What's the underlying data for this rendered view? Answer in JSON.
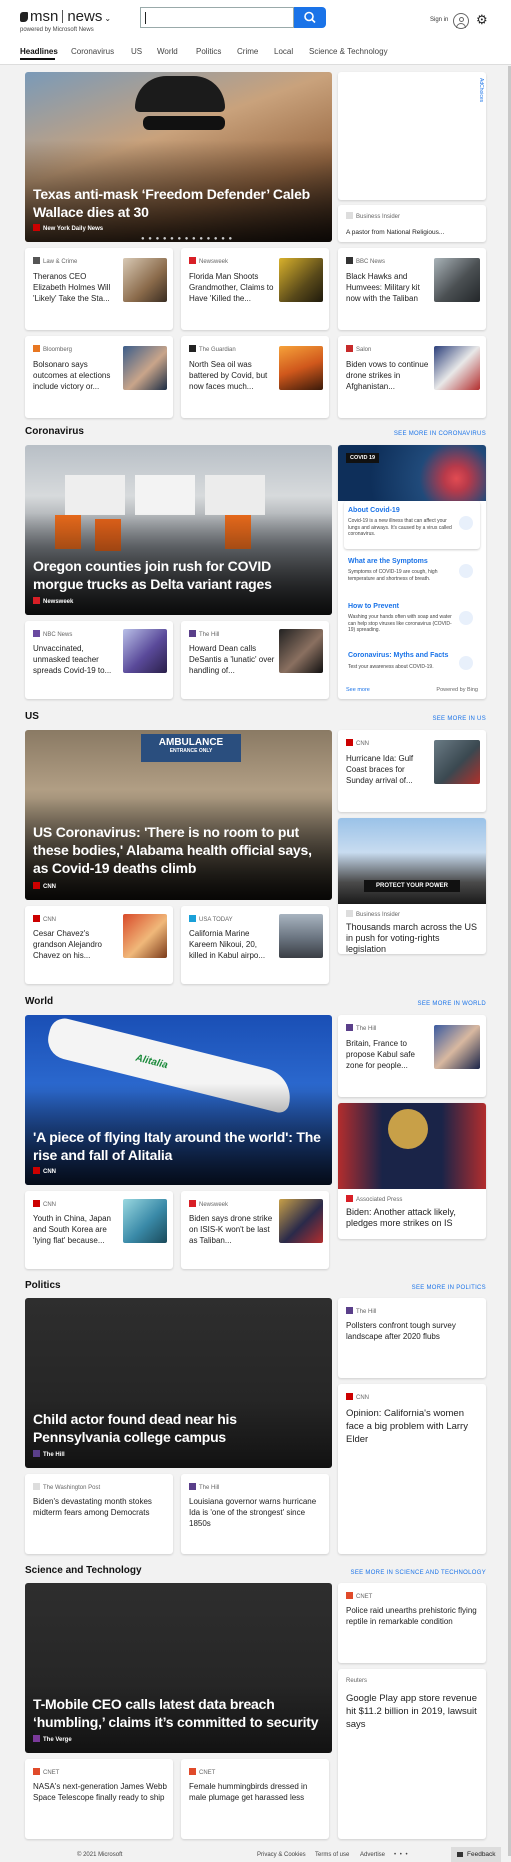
{
  "header": {
    "brand": "msn",
    "section": "news",
    "powered_by": "powered by Microsoft News",
    "search_placeholder": "",
    "sign_in": "Sign in"
  },
  "nav": [
    "Headlines",
    "Coronavirus",
    "US",
    "World",
    "Politics",
    "Crime",
    "Local",
    "Science & Technology"
  ],
  "ad": {
    "label": "AdChoices"
  },
  "top": {
    "hero": {
      "title": "Texas anti-mask ‘Freedom Defender’ Caleb Wallace dies at 30",
      "source": "New York Daily News"
    },
    "side": {
      "source": "Business Insider",
      "title": "A pastor from National Religious..."
    },
    "row1": [
      {
        "source": "Law & Crime",
        "title": "Theranos CEO Elizabeth Holmes Will 'Likely' Take the Sta..."
      },
      {
        "source": "Newsweek",
        "title": "Florida Man Shoots Grandmother, Claims to Have 'Killed the..."
      },
      {
        "source": "BBC News",
        "title": "Black Hawks and Humvees: Military kit now with the Taliban"
      }
    ],
    "row2": [
      {
        "source": "Bloomberg",
        "title": "Bolsonaro says outcomes at elections include victory or..."
      },
      {
        "source": "The Guardian",
        "title": "North Sea oil was battered by Covid, but now faces much..."
      },
      {
        "source": "Salon",
        "title": "Biden vows to continue drone strikes in Afghanistan..."
      }
    ]
  },
  "coronavirus": {
    "heading": "Coronavirus",
    "more": "SEE MORE IN CORONAVIRUS",
    "hero": {
      "title": "Oregon counties join rush for COVID morgue trucks as Delta variant rages",
      "source": "Newsweek"
    },
    "cards": [
      {
        "source": "NBC News",
        "title": "Unvaccinated, unmasked teacher spreads Covid-19 to..."
      },
      {
        "source": "The Hill",
        "title": "Howard Dean calls DeSantis a 'lunatic' over handling of..."
      }
    ],
    "widget": {
      "badge": "COVID 19",
      "items": [
        {
          "title": "About Covid-19",
          "text": "Covid-19 is a new illness that can affect your lungs and airways. It's caused by a virus called coronavirus."
        },
        {
          "title": "What are the Symptoms",
          "text": "Symptoms of COVID-19 are cough, high temperature and shortness of breath."
        },
        {
          "title": "How to Prevent",
          "text": "Washing your hands often with soap and water can help stop viruses like coronavirus (COVID-19) spreading."
        },
        {
          "title": "Coronavirus: Myths and Facts",
          "text": "Test your awareness about COVID-19."
        }
      ],
      "see_more": "See more",
      "powered": "Powered by Bing"
    }
  },
  "us": {
    "heading": "US",
    "more": "SEE MORE IN US",
    "hero": {
      "title": "US Coronavirus: 'There is no room to put these bodies,' Alabama health official says, as Covid-19 deaths climb",
      "source": "CNN",
      "sign1": "AMBULANCE",
      "sign2": "ENTRANCE ONLY"
    },
    "side1": {
      "source": "CNN",
      "title": "Hurricane Ida: Gulf Coast braces for Sunday arrival of..."
    },
    "side2": {
      "source": "Business Insider",
      "title": "Thousands march across the US in push for voting-rights legislation",
      "banner": "PROTECT YOUR POWER"
    },
    "cards": [
      {
        "source": "CNN",
        "title": "Cesar Chavez's grandson Alejandro Chavez on his..."
      },
      {
        "source": "USA TODAY",
        "title": "California Marine Kareem Nikoui, 20, killed in Kabul airpo..."
      }
    ]
  },
  "world": {
    "heading": "World",
    "more": "SEE MORE IN WORLD",
    "hero": {
      "title": "'A piece of flying Italy around the world': The rise and fall of Alitalia",
      "source": "CNN",
      "plane_text": "Alitalia"
    },
    "side1": {
      "source": "The Hill",
      "title": "Britain, France to propose Kabul safe zone for people..."
    },
    "side2": {
      "source": "Associated Press",
      "title": "Biden: Another attack likely, pledges more strikes on IS"
    },
    "cards": [
      {
        "source": "CNN",
        "title": "Youth in China, Japan and South Korea are 'lying flat' because..."
      },
      {
        "source": "Newsweek",
        "title": "Biden says drone strike on ISIS-K won't be last as Taliban..."
      }
    ]
  },
  "politics": {
    "heading": "Politics",
    "more": "SEE MORE IN POLITICS",
    "hero": {
      "title": "Child actor found dead near his Pennsylvania college campus",
      "source": "The Hill"
    },
    "side1": {
      "source": "The Hill",
      "title": "Pollsters confront tough survey landscape after 2020 flubs"
    },
    "side2": {
      "source": "CNN",
      "title": "Opinion: California's women face a big problem with Larry Elder"
    },
    "cards": [
      {
        "source": "The Washington Post",
        "title": "Biden's devastating month stokes midterm fears among Democrats"
      },
      {
        "source": "The Hill",
        "title": "Louisiana governor warns hurricane Ida is 'one of the strongest' since 1850s"
      }
    ]
  },
  "science": {
    "heading": "Science and Technology",
    "more": "SEE MORE IN SCIENCE AND TECHNOLOGY",
    "hero": {
      "title": "T-Mobile CEO calls latest data breach ‘humbling,’ claims it’s committed to security",
      "source": "The Verge"
    },
    "side1": {
      "source": "CNET",
      "title": "Police raid unearths prehistoric flying reptile in remarkable condition"
    },
    "side2": {
      "source": "Reuters",
      "title": "Google Play app store revenue hit $11.2 billion in 2019, lawsuit says"
    },
    "cards": [
      {
        "source": "CNET",
        "title": "NASA's next-generation James Webb Space Telescope finally ready to ship"
      },
      {
        "source": "CNET",
        "title": "Female hummingbirds dressed in male plumage get harassed less"
      }
    ]
  },
  "footer": {
    "copyright": "© 2021 Microsoft",
    "privacy": "Privacy & Cookies",
    "terms": "Terms of use",
    "advertise": "Advertise",
    "more": "• • •",
    "feedback": "Feedback"
  },
  "colors": {
    "accent": "#1a73e8",
    "cnn": "#cc0000",
    "newsweek": "#d81f26",
    "thehill": "#5a3f8a"
  }
}
